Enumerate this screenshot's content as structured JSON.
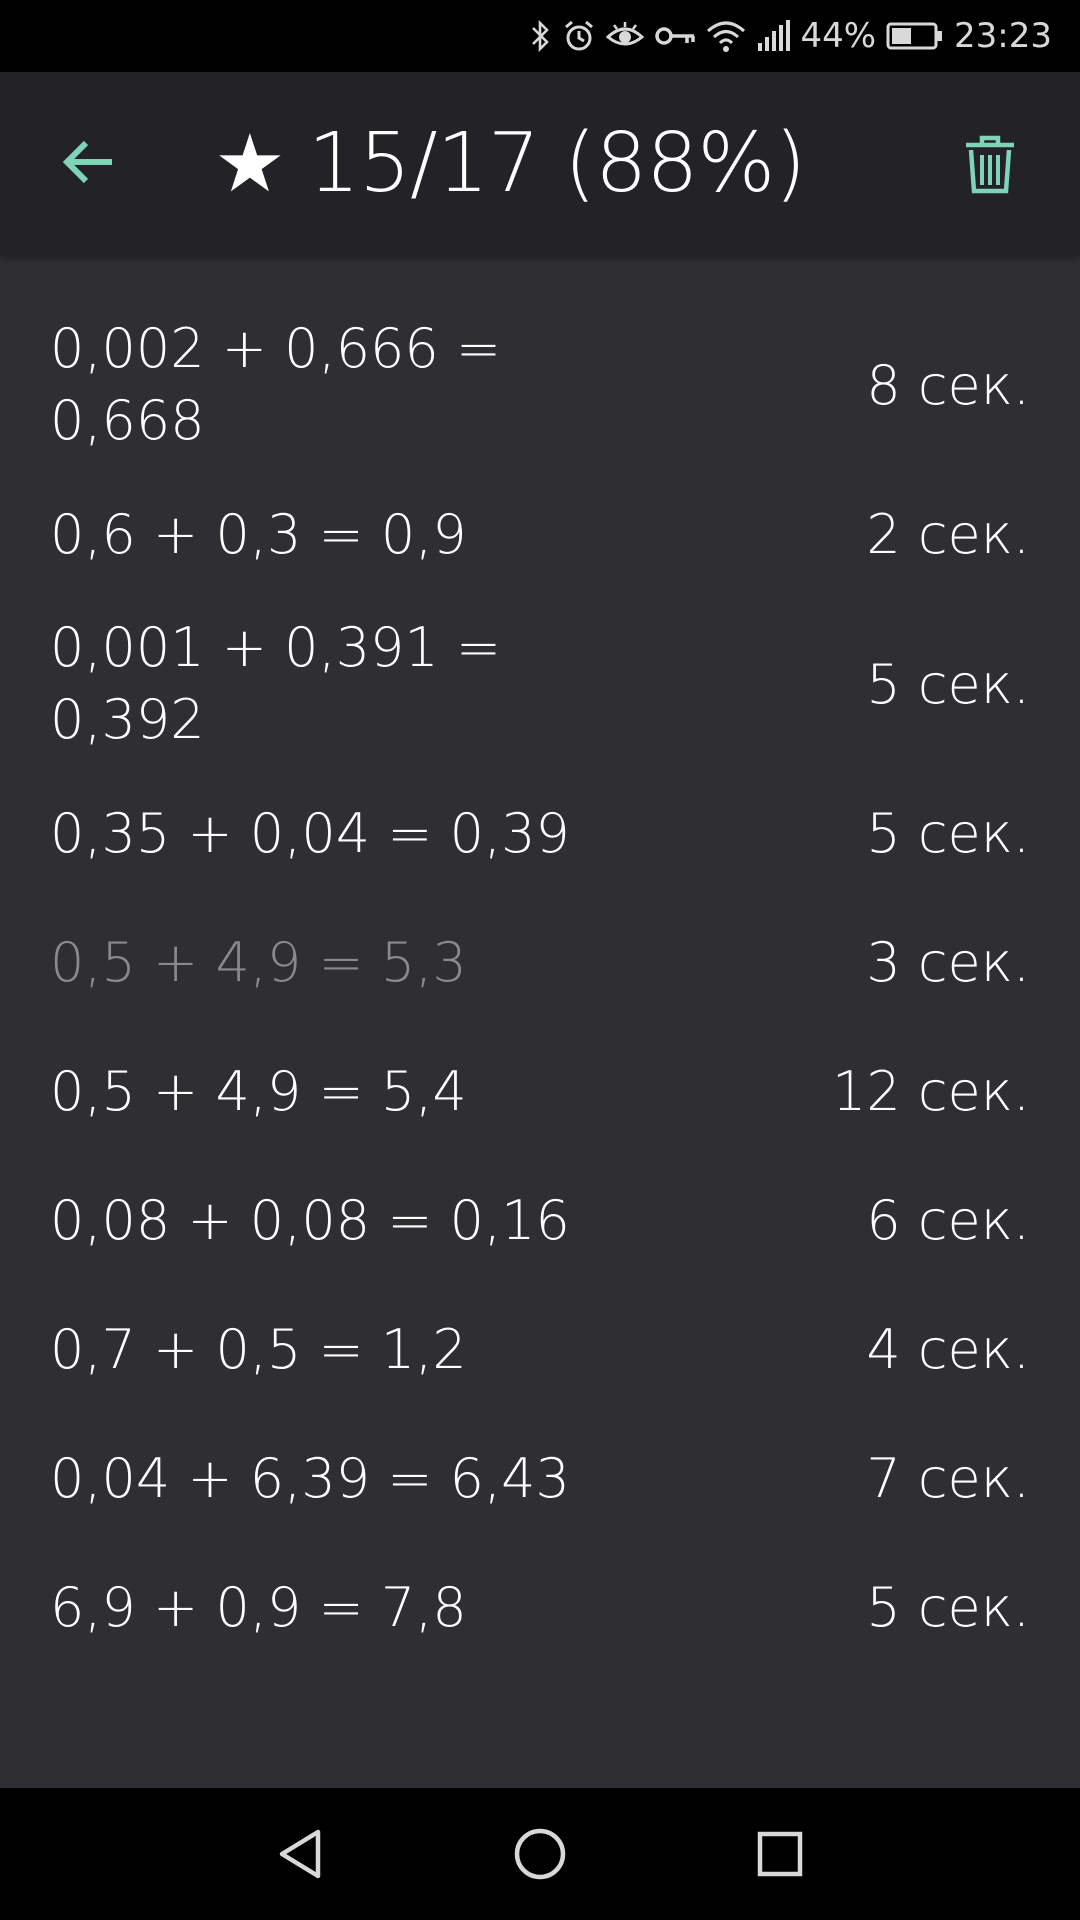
{
  "status_bar": {
    "battery_percent": "44%",
    "time": "23:23",
    "icons": [
      "bluetooth-icon",
      "alarm-icon",
      "eye-icon",
      "vpn-key-icon",
      "wifi-icon",
      "signal-icon",
      "battery-icon"
    ]
  },
  "app_bar": {
    "star": "★",
    "title": "15/17 (88%)",
    "back_icon": "arrow-back-icon",
    "delete_icon": "trash-icon",
    "accent_color": "#7fd3b6"
  },
  "results": [
    {
      "expression": "0,002 + 0,666 = 0,668",
      "time": "8 сек.",
      "correct": true
    },
    {
      "expression": "0,6 + 0,3 = 0,9",
      "time": "2 сек.",
      "correct": true
    },
    {
      "expression": "0,001 + 0,391 = 0,392",
      "time": "5 сек.",
      "correct": true
    },
    {
      "expression": "0,35 + 0,04 = 0,39",
      "time": "5 сек.",
      "correct": true
    },
    {
      "expression": "0,5 + 4,9 = 5,3",
      "time": "3 сек.",
      "correct": false
    },
    {
      "expression": "0,5 + 4,9 = 5,4",
      "time": "12 сек.",
      "correct": true
    },
    {
      "expression": "0,08 + 0,08 = 0,16",
      "time": "6 сек.",
      "correct": true
    },
    {
      "expression": "0,7 + 0,5 = 1,2",
      "time": "4 сек.",
      "correct": true
    },
    {
      "expression": "0,04 + 6,39 = 6,43",
      "time": "7 сек.",
      "correct": true
    },
    {
      "expression": "6,9 + 0,9 = 7,8",
      "time": "5 сек.",
      "correct": true
    }
  ],
  "nav_bar": {
    "icons": [
      "nav-back-icon",
      "nav-home-icon",
      "nav-recents-icon"
    ]
  }
}
